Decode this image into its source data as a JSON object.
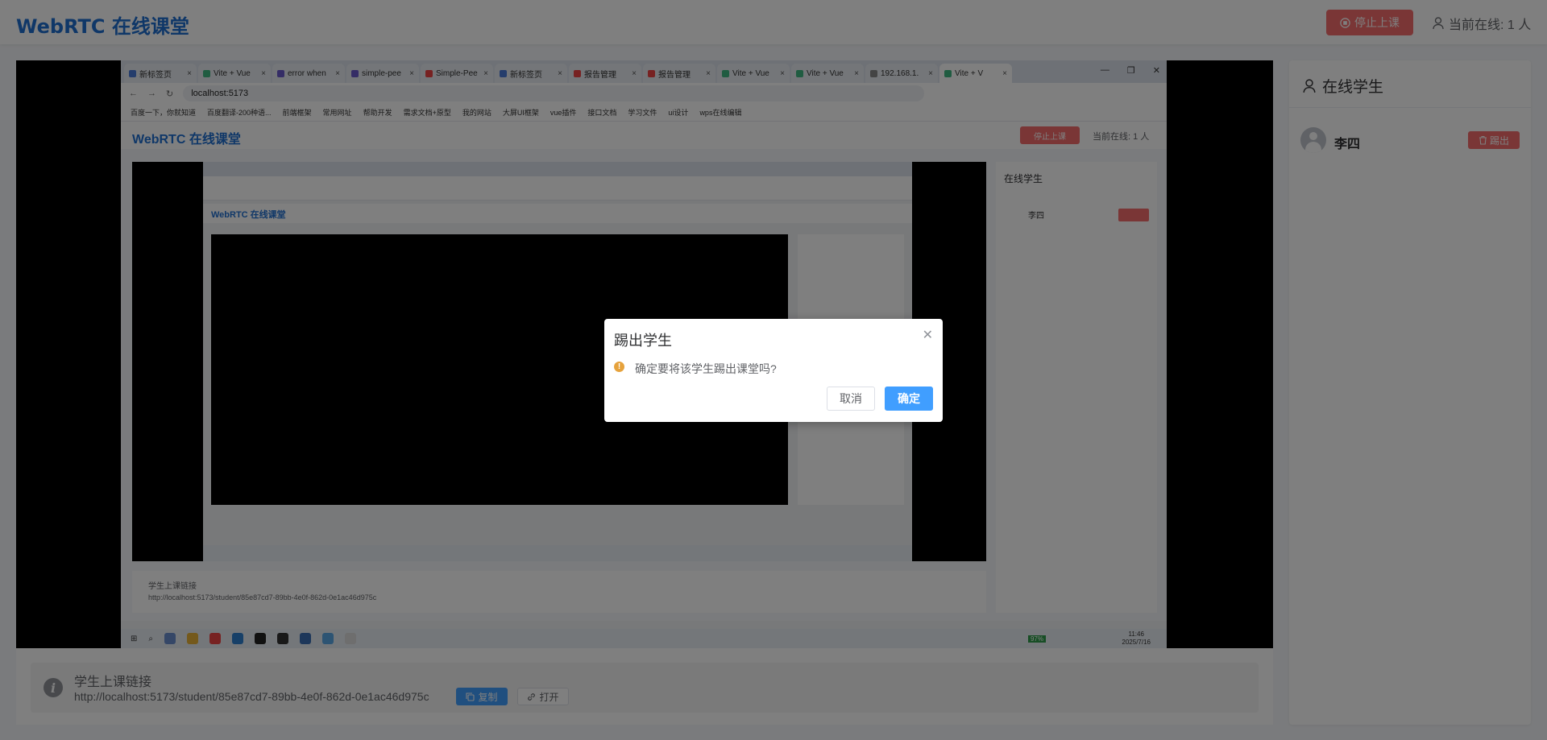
{
  "header": {
    "title": "WebRTC 在线课堂",
    "stop_label": "停止上课",
    "online_label": "当前在线: 1 人"
  },
  "sidebar": {
    "title": "在线学生",
    "students": [
      {
        "name": "李四",
        "kick_label": "踢出"
      }
    ]
  },
  "link": {
    "label": "学生上课链接",
    "url": "http://localhost:5173/student/85e87cd7-89bb-4e0f-862d-0e1ac46d975c",
    "copy_label": "复制",
    "open_label": "打开"
  },
  "shared_screen": {
    "tabs": [
      "新标签页",
      "Vite + Vue",
      "error when",
      "simple-pee",
      "Simple-Pee",
      "新标签页",
      "报告管理",
      "报告管理",
      "Vite + Vue",
      "Vite + Vue",
      "192.168.1.",
      "Vite + V"
    ],
    "address": "localhost:5173",
    "bookmarks": [
      "百度一下，你就知道",
      "百度翻译-200种语...",
      "前端框架",
      "常用网址",
      "帮助开发",
      "需求文档+原型",
      "我的网站",
      "大屏UI框架",
      "vue插件",
      "接口文档",
      "学习文件",
      "ui设计",
      "wps在线编辑"
    ],
    "app_title": "WebRTC 在线课堂",
    "stop_label": "停止上课",
    "online_label": "当前在线: 1 人",
    "side_title": "在线学生",
    "student": "李四",
    "kick_label": "踢出",
    "link_label": "学生上课链接",
    "link_url": "http://localhost:5173/student/85e87cd7-89bb-4e0f-862d-0e1ac46d975c",
    "clock": "11:46",
    "date": "2025/7/16",
    "battery": "97%"
  },
  "dialog": {
    "title": "踢出学生",
    "message": "确定要将该学生踢出课堂吗?",
    "cancel_label": "取消",
    "confirm_label": "确定"
  }
}
